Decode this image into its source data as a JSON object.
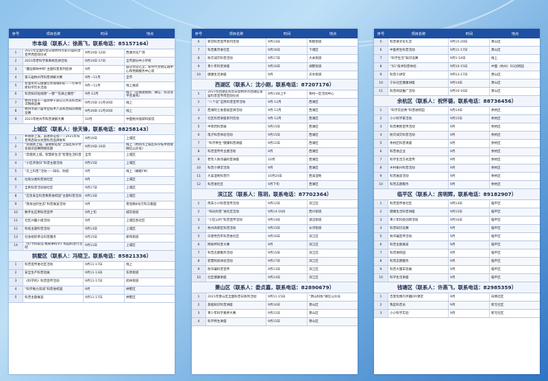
{
  "headers": {
    "no": "序号",
    "name": "项目名称",
    "time": "时间",
    "place": "地点"
  },
  "columns": [
    {
      "blocks": [
        {
          "heading": "市本级（联系人：徐燕飞，联系电话：85157164）",
          "rows": [
            [
              "1",
              "2021年全国科普日暨杭州市第10届科普宣传周启动仪式",
              "9月10日-12日",
              "西湖文化广场"
            ],
            [
              "2",
              "2021年老科学家来杭巡讲活动",
              "9月10日-17日",
              "全市部分中小学校"
            ],
            [
              "3",
              "“廉远晖映中和”主题科普系列巡讲",
              "9月",
              "部分文化礼堂、新时代文明实践中心和党群服务中心等"
            ],
            [
              "4",
              "第三届杭州市科普讲解大赛",
              "9月—11月",
              "全市"
            ],
            [
              "5",
              "智慧水务与健康饮水保障护航——引导市民科学饮水活动",
              "9月—11月",
              "线上展览"
            ],
            [
              "6",
              "科普知识短视频“一键”“先锋之播普”",
              "9月-12月",
              "线上（在线短视频、微信、抖音等平台发布）"
            ],
            [
              "7",
              "杭州市第十一届领导干部与公务员科普知识网络竞赛",
              "9月15日-11月30日",
              "线上"
            ],
            [
              "8",
              "杭州市第八届专业技术人员科普知识网络竞赛",
              "9月30日-11月30日",
              "线上"
            ],
            [
              "9",
              "2021年杭州市科普讲解大赛",
              "10月",
              "中国杭州低碳科技馆"
            ]
          ]
        },
        {
          "heading": "上城区（联系人：徐天锋，联系电话：88258143）",
          "rows": [
            [
              "1",
              "养德新上城，奋进新征程——2021年科普周启动仪式暨科普品牌发布",
              "9月16日",
              "上城区"
            ],
            [
              "2",
              "“奔跑新上城，奋进新征程”上城区科学文化知识竞赛网络答题",
              "9月10日-10日",
              "线上（杭州市上城区科学技术协会微信公众号）"
            ],
            [
              "3",
              "“奔跑新上城，智慧新生活”智慧生活科普",
              "全年",
              "上城区"
            ],
            [
              "4",
              "“小区开放日”科普主题活动",
              "9月15日",
              "上城区"
            ],
            [
              "5",
              "“云上科普”活动——知乐、防疫",
              "9月",
              "线上（蜻蜓FM）"
            ],
            [
              "6",
              "垃圾分类科普进社区",
              "9月",
              "上城区"
            ],
            [
              "7",
              "全民科普活动进社区",
              "9月17日",
              "上城区"
            ],
            [
              "8",
              "“应急安全科普教育进校园”主题科普活动",
              "9月13日",
              "上城区"
            ],
            [
              "9",
              "“我身边的生态”科普展览活动",
              "9月",
              "景昆路8号万科汉嘉园"
            ],
            [
              "10",
              "数字化应用科普宣传",
              "9月上旬",
              "城东街道"
            ],
            [
              "11",
              "社区兴趣小组活动",
              "9月",
              "上城区各社区"
            ],
            [
              "12",
              "科技主题科普活动",
              "9月13日",
              "上城区"
            ],
            [
              "13",
              "社会组织参与科普服务",
              "9月15日",
              "新和街道"
            ],
            [
              "14",
              "《打卡科技馆·我来讲科学》校园科普行活动",
              "9月11日",
              "上城区"
            ]
          ]
        },
        {
          "heading": "拱墅区（联系人：冯晓卫，联系电话：85821336）",
          "rows": [
            [
              "1",
              "科普宣传进社区活动",
              "9月11-17日",
              "线上"
            ],
            [
              "2",
              "安全生产科普巡展",
              "9月11-13日",
              "东新街道"
            ],
            [
              "3",
              "《科学的》科普宣传活动",
              "9月11-17日",
              "武林街道"
            ],
            [
              "4",
              "“科学助力双减”科普进校园",
              "9月",
              "拱墅区"
            ],
            [
              "5",
              "科普主题展览",
              "9月11-17日",
              "拱墅区"
            ]
          ]
        }
      ]
    },
    {
      "blocks": [
        {
          "heading": "",
          "rows": [
            [
              "6",
              "新冠科普宣传系列活动",
              "9月14日",
              "和睦街道"
            ],
            [
              "7",
              "科普集市进社区",
              "9月16日",
              "下城区"
            ],
            [
              "8",
              "防灾减灾科普活动",
              "9月17日",
              "大关街道"
            ],
            [
              "9",
              "青少年科普讲座",
              "9月16日",
              "湖墅街道"
            ],
            [
              "10",
              "健康生活讲座",
              "9月",
              "天水街道"
            ]
          ]
        },
        {
          "heading": "西湖区（联系人：沈小刚，联系电话：87207176）",
          "rows": [
            [
              "1",
              "2021年西湖区科普日暨杭州市西湖区第届科普宣传周启动仪式",
              "9月13日上午",
              "蒋村一区活动中心"
            ],
            [
              "2",
              "“八个议”全民科普宣传活动",
              "9月-12月",
              "西湖区"
            ],
            [
              "3",
              "西湖院士进基层宣讲活动",
              "9月-12月",
              "西湖区"
            ],
            [
              "4",
              "社区科普讲座系列活动",
              "9月-12月",
              "西湖区"
            ],
            [
              "5",
              "中草药科普展",
              "9月15日",
              "西湖区"
            ],
            [
              "6",
              "电子科普体验活动",
              "9月15日",
              "西湖区"
            ],
            [
              "7",
              "“科学养生”健康科普讲座",
              "9月12日",
              "西湖区"
            ],
            [
              "8",
              "科普宣传月主题活动",
              "9月",
              "西湖区"
            ],
            [
              "9",
              "老年人防诈骗科普讲座",
              "10月",
              "西湖区"
            ],
            [
              "10",
              "科普小课堂活动",
              "9月",
              "西湖区"
            ],
            [
              "11",
              "大美湿地科普行",
              "10月24日",
              "西溪湿地"
            ],
            [
              "12",
              "科普进社区",
              "9月下旬",
              "西湖区"
            ]
          ]
        },
        {
          "heading": "滨江区（联系人：陈玥，联系电话：87702364）",
          "rows": [
            [
              "1",
              "周末小小科普宣传活动",
              "9月12日",
              "滨江区"
            ],
            [
              "2",
              "“阳光科普”进社区活动",
              "9月14-16日",
              "西兴街道"
            ],
            [
              "3",
              "“小区公约”科普宣传活动",
              "9月14日",
              "浦沿街道"
            ],
            [
              "4",
              "杭州高新区科普活动",
              "9月15日",
              "长河街道"
            ],
            [
              "5",
              "庆建党百年科普进社区",
              "9月16日",
              "滨江区"
            ],
            [
              "6",
              "网易杯科普大赛",
              "9月",
              "滨江区"
            ],
            [
              "7",
              "科普志愿服务活动",
              "9月15日",
              "滨江区"
            ],
            [
              "8",
              "智慧科技体验活动",
              "9月17日",
              "滨江区"
            ],
            [
              "9",
              "防诈骗科普宣传",
              "9月13日",
              "滨江区"
            ],
            [
              "10",
              "社区健康讲座",
              "9月14日",
              "滨江区"
            ]
          ]
        },
        {
          "heading": "萧山区（联系人：娄贞嘉，联系电话：82890679）",
          "rows": [
            [
              "1",
              "2021年萧山区全国科普日系列活动",
              "9月11-15日",
              "“萧山科协”微信公众号"
            ],
            [
              "2",
              "基础知识科普讲座",
              "9月16日",
              "萧山区"
            ],
            [
              "3",
              "青少年科学素养大赛",
              "9月12日",
              "萧山区"
            ],
            [
              "4",
              "科学养生讲座",
              "9月15日",
              "萧山区"
            ]
          ]
        }
      ]
    },
    {
      "blocks": [
        {
          "heading": "",
          "rows": [
            [
              "5",
              "科普进文化礼堂",
              "9月15-20日",
              "萧山区"
            ],
            [
              "6",
              "中医养生科普活动",
              "9月11-17日",
              "萧山区"
            ],
            [
              "7",
              "“科学生活”知识竞赛",
              "9月1-19日",
              "线上"
            ],
            [
              "8",
              "“5G”技术科普体验",
              "9月10-15日",
              "中国（杭州）5G创新园"
            ],
            [
              "9",
              "科普小讲堂",
              "9月13-17日",
              "萧山区"
            ],
            [
              "10",
              "宁乐社区健康讲座",
              "9月14日",
              "萧山区"
            ],
            [
              "11",
              "科普阅读推广活动",
              "9月10-16日",
              "萧山区"
            ]
          ]
        },
        {
          "heading": "余杭区（联系人：祝怀德，联系电话：88736456）",
          "rows": [
            [
              "1",
              "“科学实验秀”科普进校园",
              "9月14日",
              "余杭区"
            ],
            [
              "2",
              "小小科学家活动",
              "9月15日",
              "余杭区"
            ],
            [
              "3",
              "科普惠民宣传活动",
              "9月",
              "余杭区"
            ],
            [
              "4",
              "防灾减灾科普活动",
              "9月",
              "余杭区"
            ],
            [
              "5",
              "余杭区科普讲座",
              "9月",
              "余杭区"
            ],
            [
              "6",
              "科普进企业",
              "9月",
              "余杭区"
            ],
            [
              "7",
              "科学生活方式宣传",
              "9月",
              "余杭区"
            ],
            [
              "8",
              "乡村振兴科普活动",
              "9月",
              "余杭区"
            ],
            [
              "9",
              "科普展览活动",
              "9月",
              "余杭区"
            ],
            [
              "10",
              "科普志愿服务",
              "9月",
              "余杭区"
            ]
          ]
        },
        {
          "heading": "临平区（联系人：房明辉，联系电话：89182907）",
          "rows": [
            [
              "1",
              "科普宣传进社区",
              "9月14日",
              "临平区"
            ],
            [
              "2",
              "健康生活科普讲座",
              "9月15日",
              "临平区"
            ],
            [
              "3",
              "青少年科技创新活动",
              "9月16日",
              "临平区"
            ],
            [
              "4",
              "科普知识竞赛",
              "9月",
              "临平区"
            ],
            [
              "5",
              "防诈骗宣传活动",
              "9月",
              "临平区"
            ],
            [
              "6",
              "科普主题展览",
              "9月",
              "临平区"
            ],
            [
              "7",
              "科普进校园",
              "9月",
              "临平区"
            ],
            [
              "8",
              "科普志愿服务",
              "9月",
              "临平区"
            ],
            [
              "9",
              "科普大篷车巡展",
              "9月",
              "临平区"
            ],
            [
              "10",
              "科学生活讲座",
              "9月",
              "临平区"
            ]
          ]
        },
        {
          "heading": "钱塘区（联系人：许燕飞，联系电话：82985359）",
          "rows": [
            [
              "1",
              "百变玩偶巧手趣DIY课堂",
              "9月",
              "白杨社区"
            ],
            [
              "2",
              "我是科普员",
              "9月",
              "新元社区"
            ],
            [
              "3",
              "小小科学实验",
              "9月",
              "新元社区"
            ]
          ]
        }
      ]
    }
  ]
}
